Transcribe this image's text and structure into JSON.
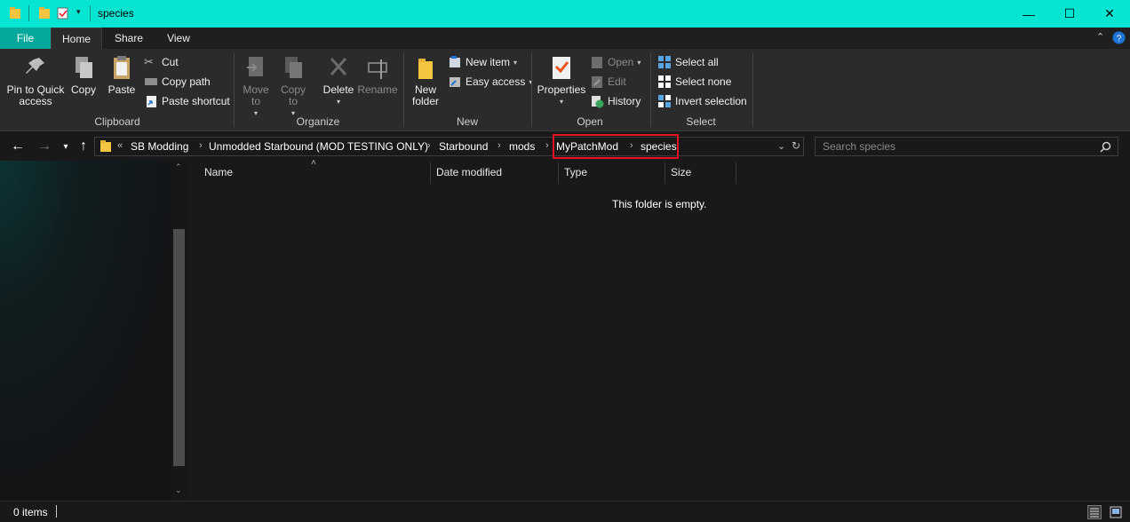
{
  "window": {
    "title": "species",
    "minimize_glyph": "—",
    "maximize_glyph": "☐",
    "close_glyph": "✕"
  },
  "ribbon_tabs": [
    "File",
    "Home",
    "Share",
    "View"
  ],
  "ribbon": {
    "clipboard": {
      "label": "Clipboard",
      "pin": "Pin to Quick access",
      "copy": "Copy",
      "paste": "Paste",
      "cut": "Cut",
      "copy_path": "Copy path",
      "paste_shortcut": "Paste shortcut"
    },
    "organize": {
      "label": "Organize",
      "move_to": "Move to",
      "copy_to": "Copy to",
      "delete": "Delete",
      "rename": "Rename"
    },
    "new": {
      "label": "New",
      "new_folder": "New folder",
      "new_item": "New item",
      "easy_access": "Easy access"
    },
    "open": {
      "label": "Open",
      "properties": "Properties",
      "open": "Open",
      "edit": "Edit",
      "history": "History"
    },
    "select": {
      "label": "Select",
      "select_all": "Select all",
      "select_none": "Select none",
      "invert_selection": "Invert selection"
    }
  },
  "address": {
    "overflow": "«",
    "crumbs": [
      "SB Modding",
      "Unmodded Starbound (MOD TESTING ONLY)",
      "Starbound",
      "mods",
      "MyPatchMod",
      "species"
    ]
  },
  "search": {
    "placeholder": "Search species"
  },
  "columns": [
    "Name",
    "Date modified",
    "Type",
    "Size"
  ],
  "content": {
    "empty_message": "This folder is empty."
  },
  "status": {
    "items": "0 items"
  },
  "colors": {
    "titlebar": "#05e5d2",
    "file_tab": "#05a99b",
    "highlight": "#e81123"
  }
}
